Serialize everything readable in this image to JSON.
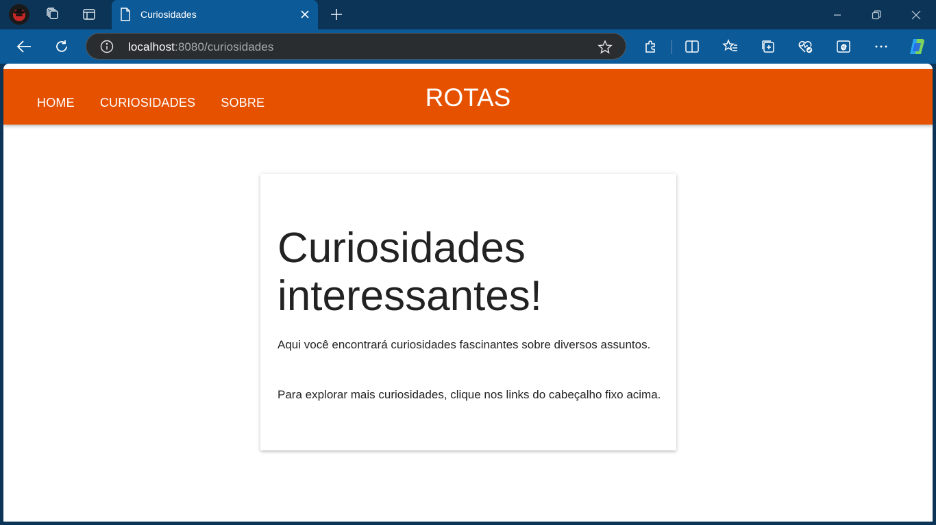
{
  "browser": {
    "tab": {
      "title": "Curiosidades"
    },
    "address": {
      "host": "localhost",
      "rest": ":8080/curiosidades"
    }
  },
  "site": {
    "nav": [
      "HOME",
      "CURIOSIDADES",
      "SOBRE"
    ],
    "brand": "ROTAS"
  },
  "content": {
    "heading": "Curiosidades interessantes!",
    "paragraphs": [
      "Aqui você encontrará curiosidades fascinantes sobre diversos assuntos.",
      "Para explorar mais curiosidades, clique nos links do cabeçalho fixo acima."
    ]
  },
  "colors": {
    "header": "#e65100",
    "chrome_dark": "#0b3457",
    "chrome_toolbar": "#0d5a98"
  }
}
